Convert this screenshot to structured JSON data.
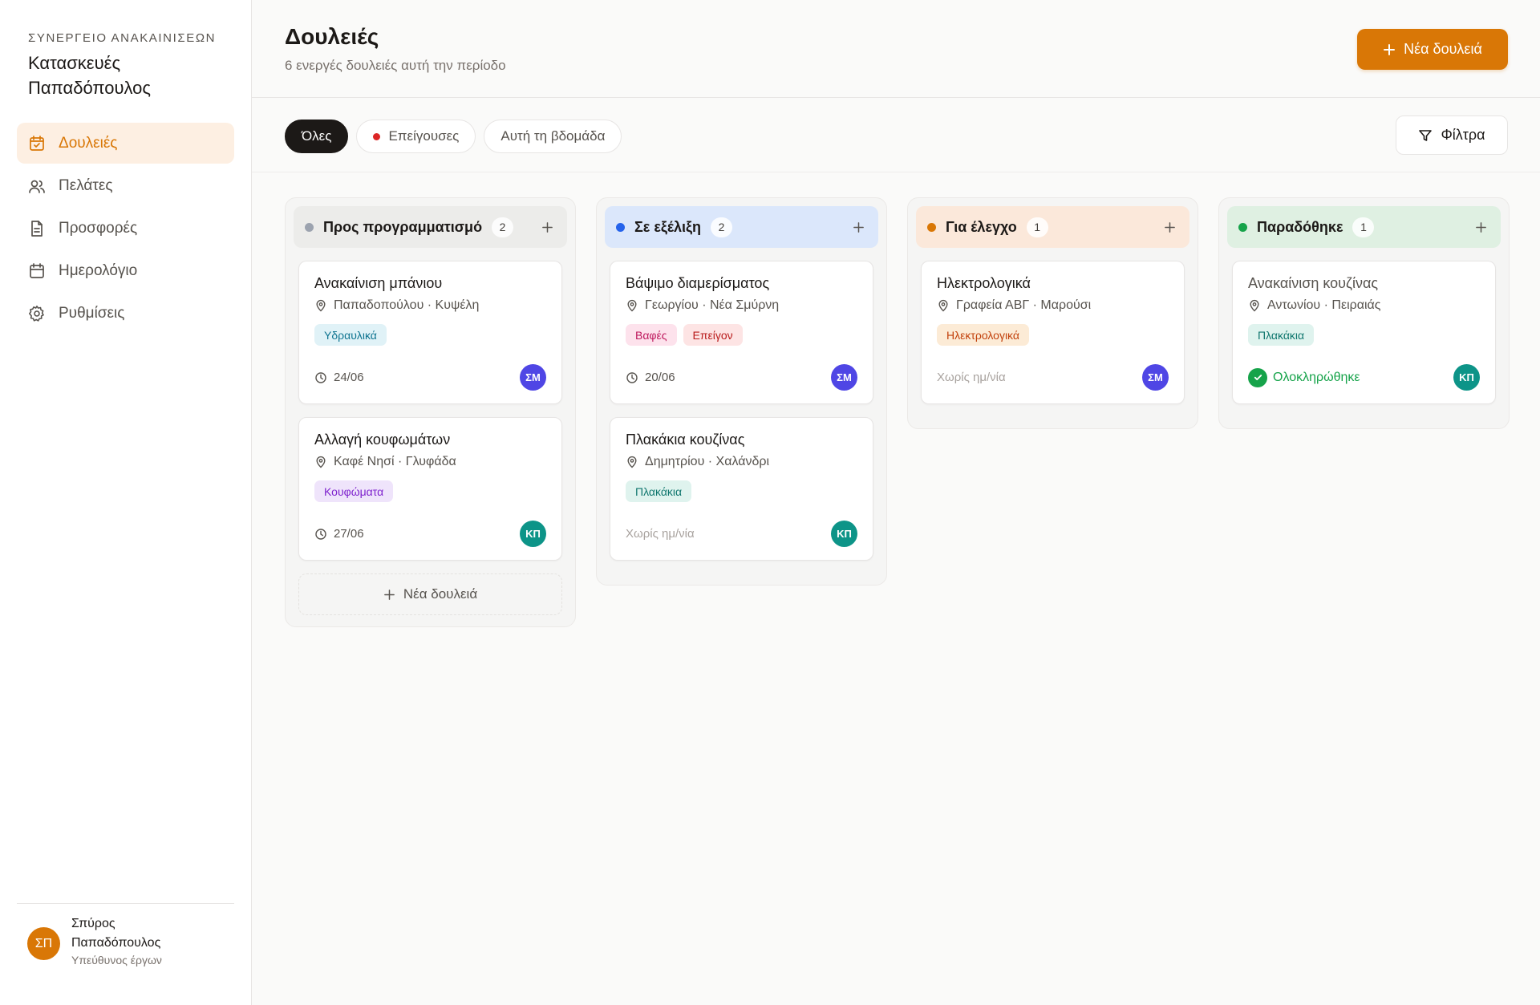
{
  "sidebar": {
    "kicker": "ΣΥΝΕΡΓΕΙΟ ΑΝΑΚΑΙΝΙΣΕΩΝ",
    "company": "Κατασκευές Παπαδόπουλος",
    "nav": [
      {
        "label": "Δουλειές",
        "icon": "checklist-icon",
        "active": true
      },
      {
        "label": "Πελάτες",
        "icon": "users-icon"
      },
      {
        "label": "Προσφορές",
        "icon": "document-icon"
      },
      {
        "label": "Ημερολόγιο",
        "icon": "calendar-icon"
      },
      {
        "label": "Ρυθμίσεις",
        "icon": "gear-icon"
      }
    ],
    "user": {
      "initials": "ΣΠ",
      "name": "Σπύρος Παπαδόπουλος",
      "role": "Υπεύθυνος έργων"
    }
  },
  "header": {
    "title": "Δουλειές",
    "subtitle": "6 ενεργές δουλειές αυτή την περίοδο",
    "new_job_label": "Νέα δουλειά"
  },
  "filters": {
    "chips": [
      "Όλες",
      "Επείγουσες",
      "Αυτή τη βδομάδα"
    ],
    "filters_label": "Φίλτρα"
  },
  "columns": [
    {
      "title": "Προς προγραμματισμό",
      "count": "2",
      "colors": {
        "dot": "#9ca3af",
        "bg": "#ececea"
      },
      "cards": [
        {
          "title": "Ανακαίνιση μπάνιου",
          "location": "Παπαδοπούλου · Κυψέλη",
          "tags": [
            "Υδραυλικά"
          ],
          "due": "24/06",
          "avatar": "ΣΜ"
        },
        {
          "title": "Αλλαγή κουφωμάτων",
          "location": "Καφέ Νησί · Γλυφάδα",
          "tags": [
            "Κουφώματα"
          ],
          "due": "27/06",
          "avatar": "ΚΠ"
        }
      ],
      "add_label": "Νέα δουλειά"
    },
    {
      "title": "Σε εξέλιξη",
      "count": "2",
      "colors": {
        "dot": "#2563eb",
        "bg": "#dbe7fb"
      },
      "cards": [
        {
          "title": "Βάψιμο διαμερίσματος",
          "location": "Γεωργίου · Νέα Σμύρνη",
          "tags": [
            "Βαφές",
            "Επείγον"
          ],
          "due": "20/06",
          "avatar": "ΣΜ"
        },
        {
          "title": "Πλακάκια κουζίνας",
          "location": "Δημητρίου · Χαλάνδρι",
          "tags": [
            "Πλακάκια"
          ],
          "due": "Χωρίς ημ/νία",
          "avatar": "ΚΠ"
        }
      ]
    },
    {
      "title": "Για έλεγχο",
      "count": "1",
      "colors": {
        "dot": "#d97706",
        "bg": "#fbe8da"
      },
      "cards": [
        {
          "title": "Ηλεκτρολογικά",
          "location": "Γραφεία ΑΒΓ · Μαρούσι",
          "tags": [
            "Ηλεκτρολογικά"
          ],
          "due": "Χωρίς ημ/νία",
          "avatar": "ΣΜ"
        }
      ]
    },
    {
      "title": "Παραδόθηκε",
      "count": "1",
      "colors": {
        "dot": "#16a34a",
        "bg": "#dff0e2"
      },
      "cards": [
        {
          "title": "Ανακαίνιση κουζίνας",
          "location": "Αντωνίου · Πειραιάς",
          "tags": [
            "Πλακάκια"
          ],
          "status": "Ολοκληρώθηκε",
          "avatar": "ΚΠ"
        }
      ]
    }
  ],
  "tag_colors": {
    "Υδραυλικά": {
      "bg": "#e0f2f7",
      "fg": "#0e7490"
    },
    "Κουφώματα": {
      "bg": "#efe4fb",
      "fg": "#7e22ce"
    },
    "Βαφές": {
      "bg": "#fde2ec",
      "fg": "#be185d"
    },
    "Επείγον": {
      "bg": "#fde4e4",
      "fg": "#b91c1c"
    },
    "Πλακάκια": {
      "bg": "#dff3ee",
      "fg": "#0f766e"
    },
    "Ηλεκτρολογικά": {
      "bg": "#fcebd6",
      "fg": "#c2410c"
    }
  },
  "avatar_colors": {
    "ΣΜ": "#4f46e5",
    "ΚΠ": "#0d9488"
  },
  "colors": {
    "accent": "#d97706",
    "success": "#16a34a",
    "urgent": "#dc2626"
  }
}
